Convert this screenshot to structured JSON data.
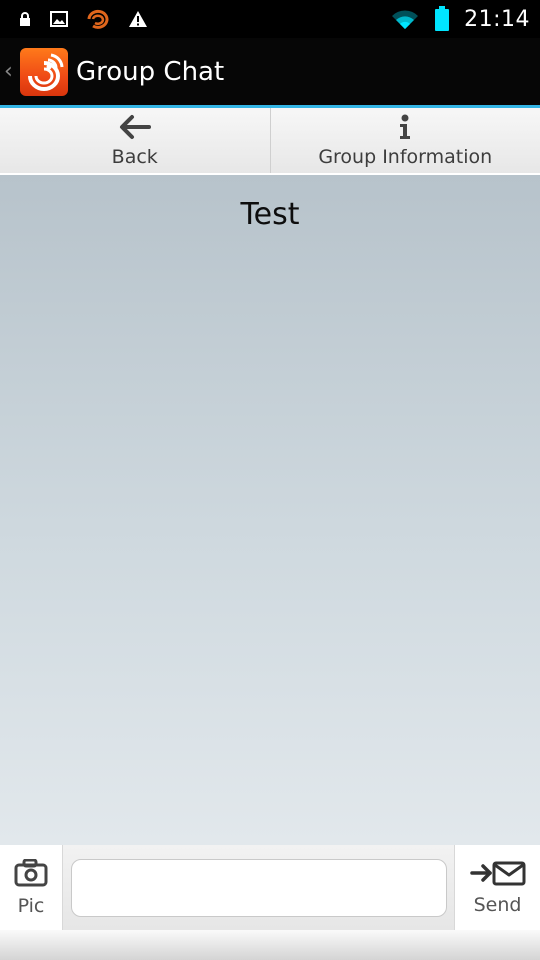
{
  "status_bar": {
    "time": "21:14",
    "left_icons": [
      "lock-icon",
      "image-icon",
      "app-notification-icon",
      "warning-icon"
    ],
    "right_icons": [
      "wifi-icon",
      "battery-icon"
    ],
    "accent_wifi": "#00e5ff",
    "accent_battery": "#00e5ff"
  },
  "action_bar": {
    "title": "Group Chat",
    "up_glyph": "‹",
    "accent_underline": "#33b5e5"
  },
  "toolbar": {
    "back_label": "Back",
    "info_label": "Group Information"
  },
  "chat": {
    "title": "Test"
  },
  "composer": {
    "pic_label": "Pic",
    "send_label": "Send",
    "input_value": "",
    "input_placeholder": ""
  }
}
